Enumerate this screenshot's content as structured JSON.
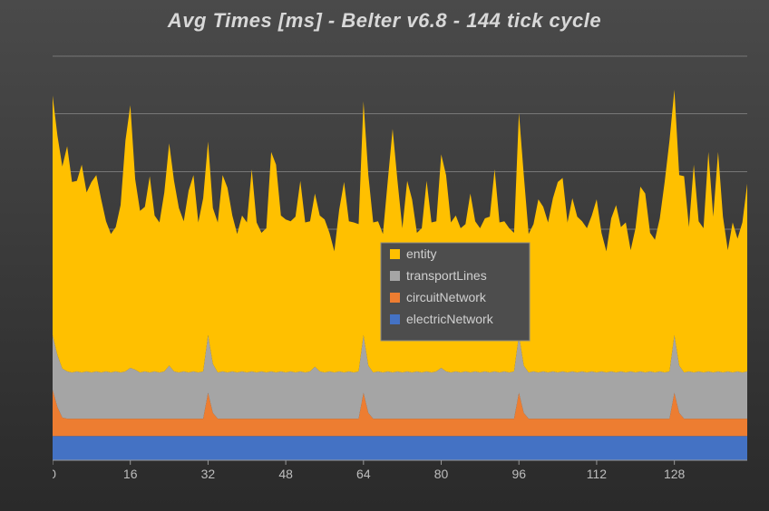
{
  "chart_data": {
    "type": "area",
    "title": "Avg Times [ms] - Belter v6.8 - 144 tick cycle",
    "xlabel": "",
    "ylabel": "",
    "xlim": [
      0,
      143
    ],
    "ylim": [
      0,
      7
    ],
    "xticks": [
      0,
      16,
      32,
      48,
      64,
      80,
      96,
      112,
      128
    ],
    "yticks": [
      0,
      1,
      2,
      3,
      4,
      5,
      6,
      7
    ],
    "stacked": true,
    "legend_position": "center-right",
    "grid": true,
    "colors": {
      "entity": "#ffc000",
      "transportLines": "#a5a5a5",
      "circuitNetwork": "#ed7d31",
      "electricNetwork": "#4472c4"
    },
    "series": [
      {
        "name": "electricNetwork",
        "values": [
          0.42,
          0.42,
          0.42,
          0.42,
          0.42,
          0.42,
          0.42,
          0.42,
          0.42,
          0.42,
          0.42,
          0.42,
          0.42,
          0.42,
          0.42,
          0.42,
          0.42,
          0.42,
          0.42,
          0.42,
          0.42,
          0.42,
          0.42,
          0.42,
          0.42,
          0.42,
          0.42,
          0.42,
          0.42,
          0.42,
          0.42,
          0.42,
          0.42,
          0.42,
          0.42,
          0.42,
          0.42,
          0.42,
          0.42,
          0.42,
          0.42,
          0.42,
          0.42,
          0.42,
          0.42,
          0.42,
          0.42,
          0.42,
          0.42,
          0.42,
          0.42,
          0.42,
          0.42,
          0.42,
          0.42,
          0.42,
          0.42,
          0.42,
          0.42,
          0.42,
          0.42,
          0.42,
          0.42,
          0.42,
          0.42,
          0.42,
          0.42,
          0.42,
          0.42,
          0.42,
          0.42,
          0.42,
          0.42,
          0.42,
          0.42,
          0.42,
          0.42,
          0.42,
          0.42,
          0.42,
          0.42,
          0.42,
          0.42,
          0.42,
          0.42,
          0.42,
          0.42,
          0.42,
          0.42,
          0.42,
          0.42,
          0.42,
          0.42,
          0.42,
          0.42,
          0.42,
          0.42,
          0.42,
          0.42,
          0.42,
          0.42,
          0.42,
          0.42,
          0.42,
          0.42,
          0.42,
          0.42,
          0.42,
          0.42,
          0.42,
          0.42,
          0.42,
          0.42,
          0.42,
          0.42,
          0.42,
          0.42,
          0.42,
          0.42,
          0.42,
          0.42,
          0.42,
          0.42,
          0.42,
          0.42,
          0.42,
          0.42,
          0.42,
          0.42,
          0.42,
          0.42,
          0.42,
          0.42,
          0.42,
          0.42,
          0.42,
          0.42,
          0.42,
          0.42,
          0.42,
          0.42,
          0.42,
          0.42,
          0.42
        ]
      },
      {
        "name": "circuitNetwork",
        "values": [
          0.8,
          0.5,
          0.32,
          0.3,
          0.3,
          0.3,
          0.3,
          0.3,
          0.3,
          0.3,
          0.3,
          0.3,
          0.3,
          0.3,
          0.3,
          0.3,
          0.3,
          0.3,
          0.3,
          0.3,
          0.3,
          0.3,
          0.3,
          0.3,
          0.3,
          0.3,
          0.3,
          0.3,
          0.3,
          0.3,
          0.3,
          0.3,
          0.75,
          0.4,
          0.3,
          0.3,
          0.3,
          0.3,
          0.3,
          0.3,
          0.3,
          0.3,
          0.3,
          0.3,
          0.3,
          0.3,
          0.3,
          0.3,
          0.3,
          0.3,
          0.3,
          0.3,
          0.3,
          0.3,
          0.3,
          0.3,
          0.3,
          0.3,
          0.3,
          0.3,
          0.3,
          0.3,
          0.3,
          0.3,
          0.75,
          0.4,
          0.3,
          0.3,
          0.3,
          0.3,
          0.3,
          0.3,
          0.3,
          0.3,
          0.3,
          0.3,
          0.3,
          0.3,
          0.3,
          0.3,
          0.3,
          0.3,
          0.3,
          0.3,
          0.3,
          0.3,
          0.3,
          0.3,
          0.3,
          0.3,
          0.3,
          0.3,
          0.3,
          0.3,
          0.3,
          0.3,
          0.75,
          0.4,
          0.3,
          0.3,
          0.3,
          0.3,
          0.3,
          0.3,
          0.3,
          0.3,
          0.3,
          0.3,
          0.3,
          0.3,
          0.3,
          0.3,
          0.3,
          0.3,
          0.3,
          0.3,
          0.3,
          0.3,
          0.3,
          0.3,
          0.3,
          0.3,
          0.3,
          0.3,
          0.3,
          0.3,
          0.3,
          0.3,
          0.75,
          0.4,
          0.3,
          0.3,
          0.3,
          0.3,
          0.3,
          0.3,
          0.3,
          0.3,
          0.3,
          0.3,
          0.3,
          0.3,
          0.3,
          0.3
        ]
      },
      {
        "name": "transportLines",
        "values": [
          0.95,
          0.9,
          0.85,
          0.82,
          0.8,
          0.82,
          0.8,
          0.82,
          0.8,
          0.82,
          0.8,
          0.82,
          0.8,
          0.82,
          0.8,
          0.82,
          0.88,
          0.85,
          0.8,
          0.82,
          0.8,
          0.82,
          0.8,
          0.82,
          0.92,
          0.82,
          0.8,
          0.82,
          0.8,
          0.82,
          0.8,
          0.82,
          1.0,
          0.85,
          0.8,
          0.82,
          0.8,
          0.82,
          0.8,
          0.82,
          0.8,
          0.82,
          0.8,
          0.82,
          0.8,
          0.82,
          0.8,
          0.82,
          0.8,
          0.82,
          0.8,
          0.82,
          0.8,
          0.82,
          0.9,
          0.82,
          0.8,
          0.82,
          0.8,
          0.82,
          0.8,
          0.82,
          0.8,
          0.82,
          1.0,
          0.82,
          0.8,
          0.82,
          0.8,
          0.82,
          0.8,
          0.82,
          0.8,
          0.82,
          0.8,
          0.82,
          0.8,
          0.82,
          0.8,
          0.82,
          0.88,
          0.82,
          0.8,
          0.82,
          0.8,
          0.82,
          0.8,
          0.82,
          0.8,
          0.82,
          0.8,
          0.82,
          0.8,
          0.82,
          0.8,
          0.82,
          1.0,
          0.82,
          0.8,
          0.82,
          0.8,
          0.82,
          0.8,
          0.82,
          0.8,
          0.82,
          0.8,
          0.82,
          0.8,
          0.82,
          0.8,
          0.82,
          0.8,
          0.82,
          0.8,
          0.82,
          0.8,
          0.82,
          0.8,
          0.82,
          0.8,
          0.82,
          0.8,
          0.82,
          0.8,
          0.82,
          0.8,
          0.82,
          1.0,
          0.82,
          0.8,
          0.82,
          0.8,
          0.82,
          0.8,
          0.82,
          0.8,
          0.82,
          0.8,
          0.82,
          0.8,
          0.82,
          0.8,
          0.82
        ]
      },
      {
        "name": "entity",
        "values": [
          4.15,
          3.8,
          3.5,
          3.9,
          3.3,
          3.3,
          3.6,
          3.1,
          3.3,
          3.4,
          3.0,
          2.6,
          2.4,
          2.5,
          2.9,
          4.0,
          4.55,
          3.3,
          2.8,
          2.85,
          3.4,
          2.7,
          2.6,
          3.1,
          3.85,
          3.3,
          2.85,
          2.6,
          3.15,
          3.4,
          2.6,
          3.0,
          3.35,
          2.7,
          2.6,
          3.4,
          3.2,
          2.7,
          2.4,
          2.7,
          2.6,
          3.5,
          2.6,
          2.4,
          2.5,
          3.8,
          3.6,
          2.7,
          2.65,
          2.6,
          2.7,
          3.3,
          2.6,
          2.6,
          3.0,
          2.7,
          2.65,
          2.4,
          2.1,
          2.8,
          3.3,
          2.6,
          2.6,
          2.55,
          4.05,
          3.3,
          2.6,
          2.6,
          2.4,
          3.3,
          4.22,
          3.3,
          2.5,
          3.3,
          3.0,
          2.4,
          2.5,
          3.3,
          2.6,
          2.6,
          3.7,
          3.4,
          2.6,
          2.7,
          2.5,
          2.55,
          3.1,
          2.6,
          2.5,
          2.65,
          2.7,
          3.5,
          2.6,
          2.6,
          2.5,
          2.4,
          3.85,
          3.3,
          2.4,
          2.55,
          3.0,
          2.85,
          2.6,
          3.0,
          3.3,
          3.35,
          2.6,
          3.0,
          2.7,
          2.6,
          2.5,
          2.7,
          3.0,
          2.4,
          2.1,
          2.65,
          2.9,
          2.5,
          2.6,
          2.1,
          2.5,
          3.2,
          3.1,
          2.4,
          2.3,
          2.65,
          3.3,
          4.0,
          4.25,
          3.3,
          3.4,
          2.5,
          3.6,
          2.6,
          2.5,
          3.8,
          2.7,
          3.8,
          2.7,
          2.1,
          2.6,
          2.3,
          2.6,
          3.25
        ]
      }
    ]
  },
  "legend": {
    "items": [
      {
        "label": "entity",
        "color": "#ffc000"
      },
      {
        "label": "transportLines",
        "color": "#a5a5a5"
      },
      {
        "label": "circuitNetwork",
        "color": "#ed7d31"
      },
      {
        "label": "electricNetwork",
        "color": "#4472c4"
      }
    ]
  }
}
